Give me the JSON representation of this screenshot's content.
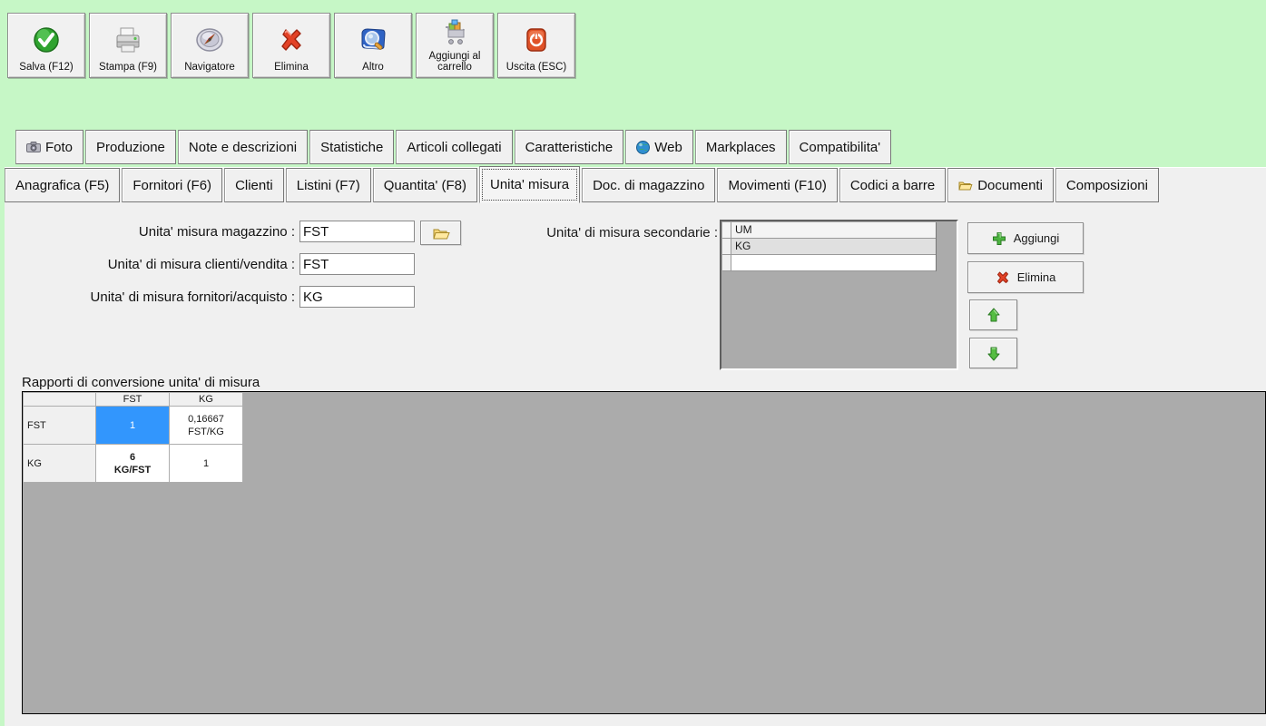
{
  "colors": {
    "window_bg": "#c6f7c6",
    "panel_bg": "#f0f0f0",
    "grid_bg": "#ababab",
    "selected_cell": "#3296fd",
    "accent_green": "#3fae3f",
    "accent_red": "#e0402a"
  },
  "toolbar": {
    "buttons": [
      {
        "label": "Salva (F12)",
        "icon": "save-check-icon"
      },
      {
        "label": "Stampa (F9)",
        "icon": "printer-icon"
      },
      {
        "label": "Navigatore",
        "icon": "compass-icon"
      },
      {
        "label": "Elimina",
        "icon": "delete-x-icon"
      },
      {
        "label": "Altro",
        "icon": "book-magnifier-icon"
      },
      {
        "label": "Aggiungi al carrello",
        "icon": "cart-icon"
      },
      {
        "label": "Uscita (ESC)",
        "icon": "power-icon"
      }
    ]
  },
  "tabs": {
    "row1": [
      {
        "label": "Foto",
        "icon": "camera-icon"
      },
      {
        "label": "Produzione"
      },
      {
        "label": "Note e descrizioni"
      },
      {
        "label": "Statistiche"
      },
      {
        "label": "Articoli collegati"
      },
      {
        "label": "Caratteristiche"
      },
      {
        "label": "Web",
        "icon": "globe-icon"
      },
      {
        "label": "Markplaces"
      },
      {
        "label": "Compatibilita'"
      }
    ],
    "row2": [
      {
        "label": "Anagrafica (F5)"
      },
      {
        "label": "Fornitori (F6)"
      },
      {
        "label": "Clienti"
      },
      {
        "label": "Listini (F7)"
      },
      {
        "label": "Quantita' (F8)"
      },
      {
        "label": "Unita' misura",
        "active": true
      },
      {
        "label": "Doc. di magazzino"
      },
      {
        "label": "Movimenti (F10)"
      },
      {
        "label": "Codici a barre"
      },
      {
        "label": "Documenti",
        "icon": "folder-icon"
      },
      {
        "label": "Composizioni"
      }
    ]
  },
  "form": {
    "fields": [
      {
        "label": "Unita' misura magazzino :",
        "value": "FST"
      },
      {
        "label": "Unita' di misura clienti/vendita :",
        "value": "FST"
      },
      {
        "label": "Unita' di misura fornitori/acquisto :",
        "value": "KG"
      }
    ],
    "secondary": {
      "label": "Unita' di misura secondarie :",
      "column_header": "UM",
      "rows": [
        "KG",
        ""
      ],
      "add_label": "Aggiungi",
      "delete_label": "Elimina"
    }
  },
  "conversion": {
    "title": "Rapporti di conversione unita' di misura",
    "columns": [
      "FST",
      "KG"
    ],
    "rows": [
      {
        "label": "FST",
        "cells": [
          {
            "line1": "1",
            "line2": "",
            "selected": true
          },
          {
            "line1": "0,16667",
            "line2": "FST/KG"
          }
        ]
      },
      {
        "label": "KG",
        "cells": [
          {
            "line1": "6",
            "line2": "KG/FST",
            "bold": true
          },
          {
            "line1": "1",
            "line2": ""
          }
        ]
      }
    ]
  }
}
